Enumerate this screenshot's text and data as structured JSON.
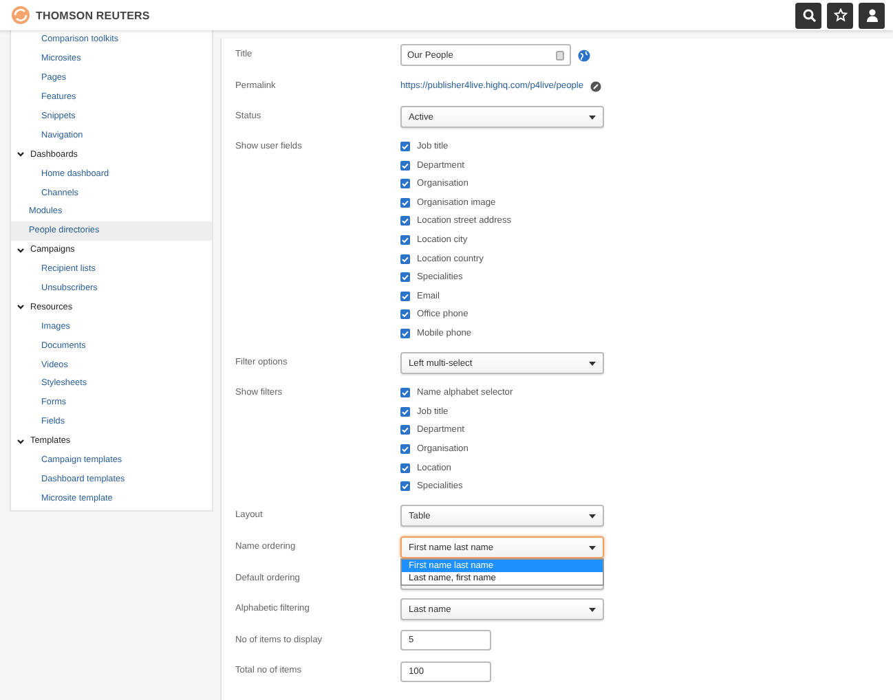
{
  "header": {
    "brand": "THOMSON REUTERS",
    "buttons": [
      {
        "kind": "search"
      },
      {
        "kind": "star"
      },
      {
        "kind": "user"
      }
    ]
  },
  "sidebar": {
    "items": [
      {
        "children": [
          {
            "label": "Comparison toolkits",
            "selected": false
          },
          {
            "label": "Microsites",
            "selected": false
          },
          {
            "label": "Pages",
            "selected": false
          },
          {
            "label": "Features",
            "selected": false
          },
          {
            "label": "Snippets",
            "selected": false
          },
          {
            "label": "Navigation",
            "selected": false
          }
        ]
      },
      {
        "label": "Dashboards",
        "expanded": true,
        "children": [
          {
            "label": "Home dashboard",
            "selected": false
          },
          {
            "label": "Channels",
            "selected": false
          }
        ]
      },
      {
        "label": "Modules",
        "selected": false
      },
      {
        "label": "People directories",
        "selected": true
      },
      {
        "label": "Campaigns",
        "expanded": true,
        "children": [
          {
            "label": "Recipient lists",
            "selected": false
          },
          {
            "label": "Unsubscribers",
            "selected": false
          }
        ]
      },
      {
        "label": "Resources",
        "expanded": true,
        "children": [
          {
            "label": "Images",
            "selected": false
          },
          {
            "label": "Documents",
            "selected": false
          },
          {
            "label": "Videos",
            "selected": false
          },
          {
            "label": "Stylesheets",
            "selected": false
          },
          {
            "label": "Forms",
            "selected": false
          },
          {
            "label": "Fields",
            "selected": false
          }
        ]
      },
      {
        "label": "Templates",
        "expanded": true,
        "children": [
          {
            "label": "Campaign templates",
            "selected": false
          },
          {
            "label": "Dashboard templates",
            "selected": false
          },
          {
            "label": "Microsite template",
            "selected": false
          }
        ]
      }
    ]
  },
  "form": {
    "rows": [
      {
        "kind": "text",
        "label": "Title",
        "value": "Our People"
      },
      {
        "kind": "link",
        "label": "Permalink",
        "value": "https://publisher4live.highq.com/p4live/people"
      },
      {
        "kind": "select",
        "label": "Status",
        "value": "Active",
        "focused": false
      },
      {
        "kind": "checkboxes",
        "label": "Show user fields",
        "options": [
          {
            "label": "Job title",
            "checked": true
          },
          {
            "label": "Department",
            "checked": true
          },
          {
            "label": "Organisation",
            "checked": true
          },
          {
            "label": "Organisation image",
            "checked": true
          },
          {
            "label": "Location street address",
            "checked": true
          },
          {
            "label": "Location city",
            "checked": true
          },
          {
            "label": "Location country",
            "checked": true
          },
          {
            "label": "Specialities",
            "checked": true
          },
          {
            "label": "Email",
            "checked": true
          },
          {
            "label": "Office phone",
            "checked": true
          },
          {
            "label": "Mobile phone",
            "checked": true
          }
        ]
      },
      {
        "kind": "select",
        "label": "Filter options",
        "value": "Left multi-select",
        "focused": false
      },
      {
        "kind": "checkboxes",
        "label": "Show filters",
        "options": [
          {
            "label": "Name alphabet selector",
            "checked": true
          },
          {
            "label": "Job title",
            "checked": true
          },
          {
            "label": "Department",
            "checked": true
          },
          {
            "label": "Organisation",
            "checked": true
          },
          {
            "label": "Location",
            "checked": true
          },
          {
            "label": "Specialities",
            "checked": true
          }
        ]
      },
      {
        "kind": "select",
        "label": "Layout",
        "value": "Table",
        "focused": false
      },
      {
        "kind": "select",
        "label": "Name ordering",
        "value": "First name last name",
        "focused": true,
        "options": [
          {
            "label": "First name last name",
            "selected": true
          },
          {
            "label": "Last name, first name",
            "selected": false
          }
        ]
      },
      {
        "kind": "select",
        "label": "Default ordering",
        "focused": false
      },
      {
        "kind": "select",
        "label": "Alphabetic filtering",
        "value": "Last name",
        "focused": false
      },
      {
        "kind": "number",
        "label": "No of items to display",
        "value": "5"
      },
      {
        "kind": "number",
        "label": "Total no of items",
        "value": "100"
      }
    ]
  }
}
